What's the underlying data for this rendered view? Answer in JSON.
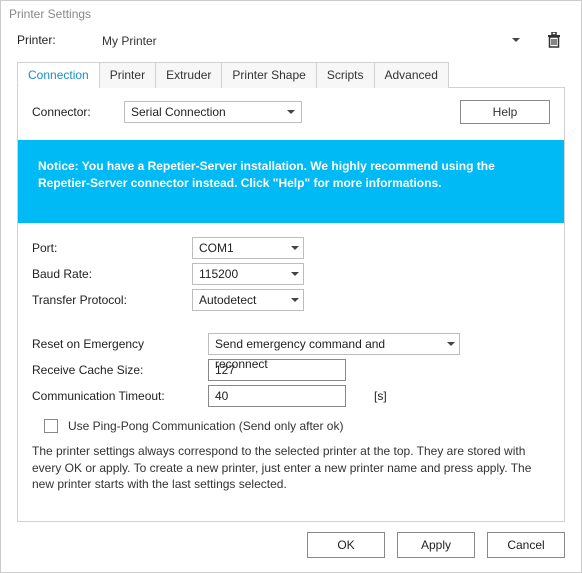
{
  "window": {
    "title": "Printer Settings"
  },
  "printerRow": {
    "label": "Printer:",
    "value": "My Printer"
  },
  "tabs": {
    "connection": "Connection",
    "printer": "Printer",
    "extruder": "Extruder",
    "shape": "Printer Shape",
    "scripts": "Scripts",
    "advanced": "Advanced"
  },
  "connectorRow": {
    "label": "Connector:",
    "value": "Serial Connection"
  },
  "helpLabel": "Help",
  "notice": "Notice: You have a Repetier-Server installation. We highly recommend using the Repetier-Server connector instead. Click \"Help\" for more informations.",
  "fields": {
    "port": {
      "label": "Port:",
      "value": "COM1"
    },
    "baud": {
      "label": "Baud Rate:",
      "value": "115200"
    },
    "protocol": {
      "label": "Transfer Protocol:",
      "value": "Autodetect"
    },
    "reset": {
      "label": "Reset on Emergency",
      "value": "Send emergency command and reconnect"
    },
    "cache": {
      "label": "Receive Cache Size:",
      "value": "127"
    },
    "timeout": {
      "label": "Communication Timeout:",
      "value": "40",
      "unit": "[s]"
    },
    "pingpong": {
      "label": "Use Ping-Pong Communication (Send only after ok)"
    }
  },
  "infoText": "The printer settings always correspond to the selected printer at the top. They are stored with every OK or apply. To create a new printer, just enter a new printer name and press apply. The new printer starts with the last settings selected.",
  "buttons": {
    "ok": "OK",
    "apply": "Apply",
    "cancel": "Cancel"
  }
}
